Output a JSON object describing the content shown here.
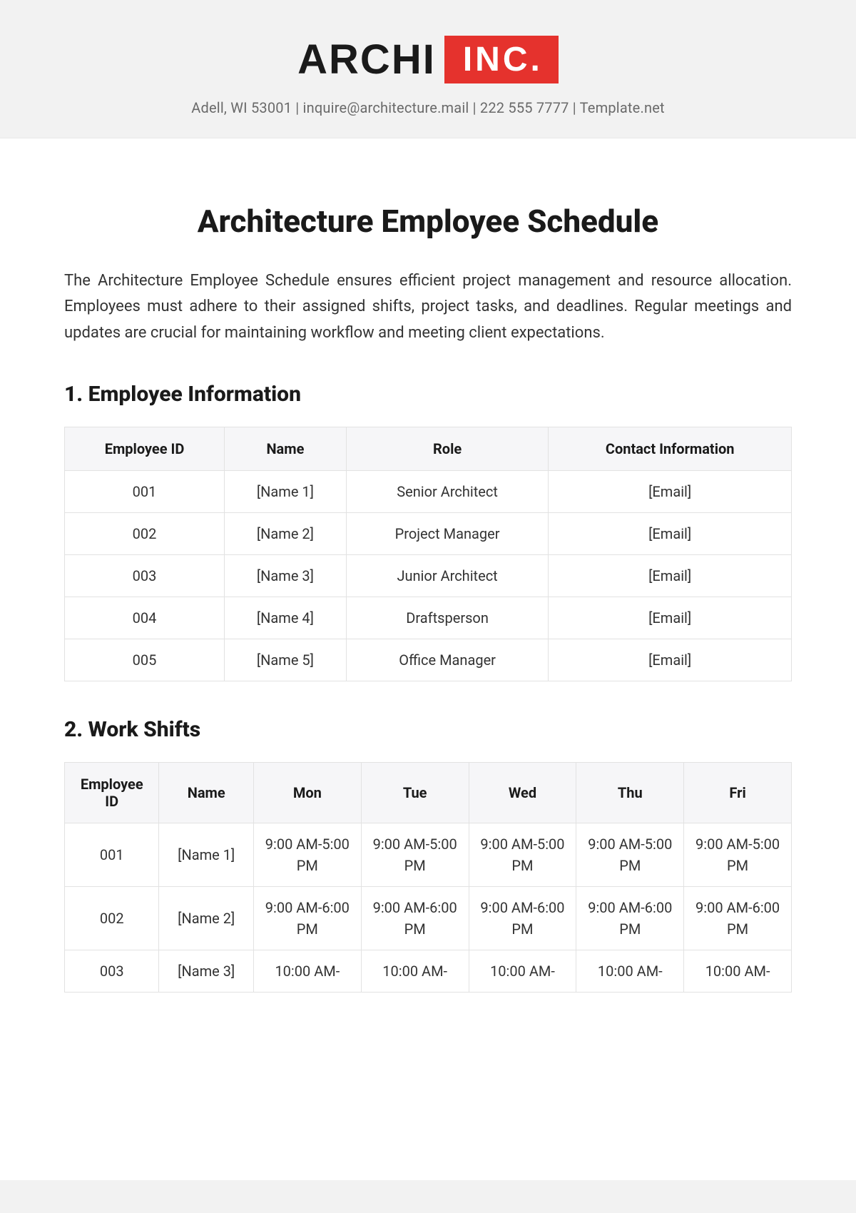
{
  "header": {
    "logo_left": "ARCHI",
    "logo_right": "INC.",
    "contact_line": "Adell, WI 53001 | inquire@architecture.mail | 222 555 7777 | Template.net"
  },
  "title": "Architecture Employee Schedule",
  "intro": "The Architecture Employee Schedule ensures efficient project management and resource allocation. Employees must adhere to their assigned shifts, project tasks, and deadlines. Regular meetings and updates are crucial for maintaining workflow and meeting client expectations.",
  "section1": {
    "heading": "1. Employee Information",
    "columns": [
      "Employee ID",
      "Name",
      "Role",
      "Contact Information"
    ],
    "rows": [
      {
        "id": "001",
        "name": "[Name 1]",
        "role": "Senior Architect",
        "contact": "[Email]"
      },
      {
        "id": "002",
        "name": "[Name 2]",
        "role": "Project Manager",
        "contact": "[Email]"
      },
      {
        "id": "003",
        "name": "[Name 3]",
        "role": "Junior Architect",
        "contact": "[Email]"
      },
      {
        "id": "004",
        "name": "[Name 4]",
        "role": "Draftsperson",
        "contact": "[Email]"
      },
      {
        "id": "005",
        "name": "[Name 5]",
        "role": "Office Manager",
        "contact": "[Email]"
      }
    ]
  },
  "section2": {
    "heading": "2. Work Shifts",
    "columns": [
      "Employee ID",
      "Name",
      "Mon",
      "Tue",
      "Wed",
      "Thu",
      "Fri"
    ],
    "rows": [
      {
        "id": "001",
        "name": "[Name 1]",
        "mon": "9:00 AM-5:00 PM",
        "tue": "9:00 AM-5:00 PM",
        "wed": "9:00 AM-5:00 PM",
        "thu": "9:00 AM-5:00 PM",
        "fri": "9:00 AM-5:00 PM"
      },
      {
        "id": "002",
        "name": "[Name 2]",
        "mon": "9:00 AM-6:00 PM",
        "tue": "9:00 AM-6:00 PM",
        "wed": "9:00 AM-6:00 PM",
        "thu": "9:00 AM-6:00 PM",
        "fri": "9:00 AM-6:00 PM"
      },
      {
        "id": "003",
        "name": "[Name 3]",
        "mon": "10:00 AM-",
        "tue": "10:00 AM-",
        "wed": "10:00 AM-",
        "thu": "10:00 AM-",
        "fri": "10:00 AM-"
      }
    ]
  }
}
